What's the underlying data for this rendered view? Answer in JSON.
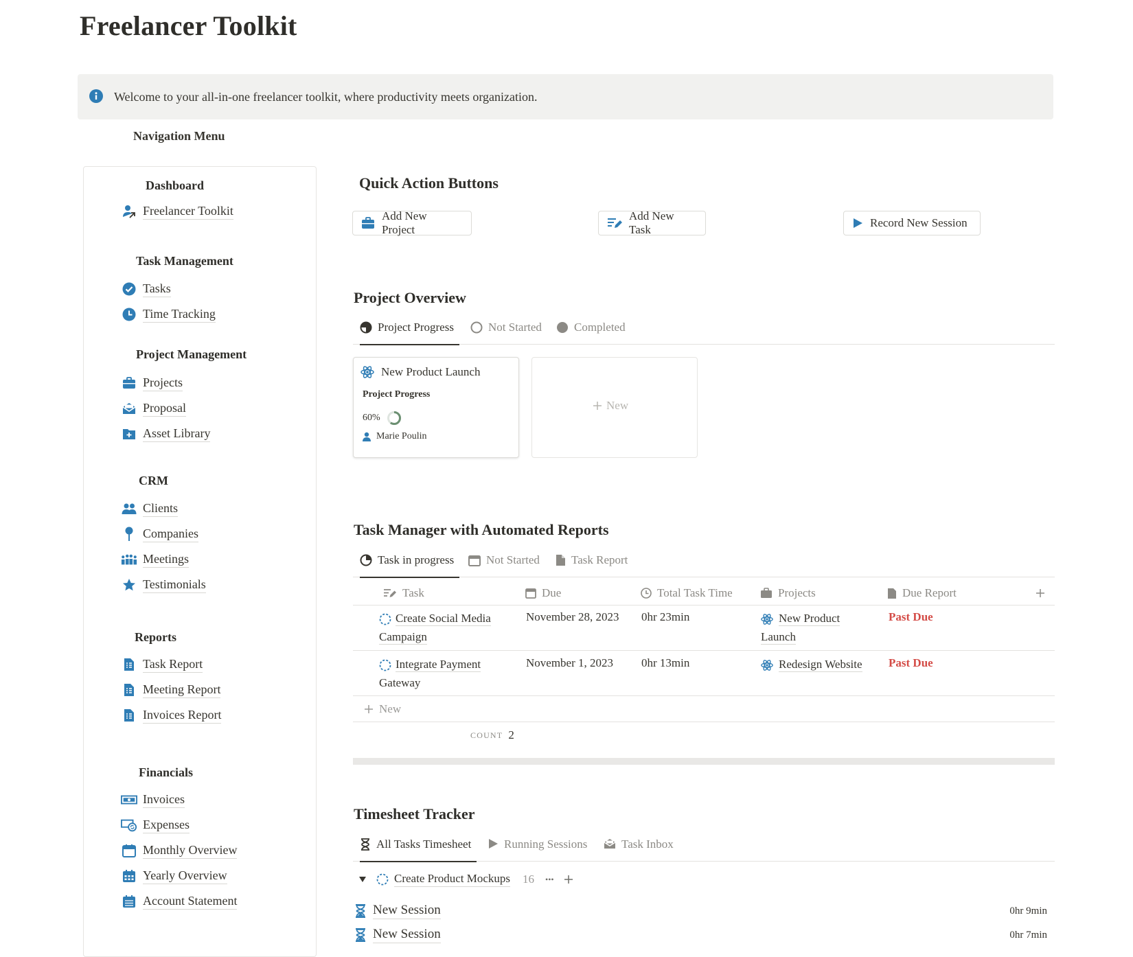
{
  "page": {
    "title": "Freelancer Toolkit"
  },
  "callout": {
    "text": "Welcome to your all-in-one freelancer toolkit, where productivity meets organization."
  },
  "nav": {
    "heading": "Navigation Menu",
    "sections": {
      "dashboard": "Dashboard",
      "task_management": "Task Management",
      "project_management": "Project Management",
      "crm": "CRM",
      "reports": "Reports",
      "financials": "Financials"
    },
    "items": {
      "freelancer_toolkit": "Freelancer Toolkit",
      "tasks": "Tasks",
      "time_tracking": "Time Tracking",
      "projects": "Projects",
      "proposal": "Proposal",
      "asset_library": "Asset Library",
      "clients": "Clients",
      "companies": "Companies",
      "meetings": "Meetings",
      "testimonials": "Testimonials",
      "task_report": "Task Report",
      "meeting_report": "Meeting Report",
      "invoices_report": "Invoices Report",
      "invoices": "Invoices",
      "expenses": "Expenses",
      "monthly_overview": "Monthly Overview",
      "yearly_overview": "Yearly Overview",
      "account_statement": "Account Statement"
    }
  },
  "quick_actions": {
    "title": "Quick Action Buttons",
    "add_project": "Add New Project",
    "add_task": "Add New Task",
    "record_session": "Record New Session"
  },
  "project_overview": {
    "title": "Project Overview",
    "tabs": {
      "progress": "Project Progress",
      "not_started": "Not Started",
      "completed": "Completed"
    },
    "card": {
      "name": "New Product Launch",
      "progress_label": "Project Progress",
      "progress_text": "60%",
      "progress_value": 0.6,
      "owner": "Marie Poulin"
    },
    "new_label": "New"
  },
  "task_manager": {
    "title": "Task Manager with Automated Reports",
    "tabs": {
      "in_progress": "Task in progress",
      "not_started": "Not Started",
      "report": "Task Report"
    },
    "columns": {
      "task": "Task",
      "due": "Due",
      "time": "Total Task Time",
      "projects": "Projects",
      "due_report": "Due Report"
    },
    "rows": [
      {
        "task_l1": "Create Social Media",
        "task_l2": "Campaign",
        "due": "November 28, 2023",
        "time": "0hr 23min",
        "project_l1": "New Product",
        "project_l2": "Launch",
        "report": "Past Due"
      },
      {
        "task_l1": "Integrate Payment",
        "task_l2": "Gateway",
        "due": "November 1, 2023",
        "time": "0hr 13min",
        "project_l1": "Redesign Website",
        "project_l2": "",
        "report": "Past Due"
      }
    ],
    "new_label": "New",
    "count_label": "COUNT",
    "count_value": "2"
  },
  "timesheet": {
    "title": "Timesheet Tracker",
    "tabs": {
      "all": "All Tasks Timesheet",
      "running": "Running Sessions",
      "inbox": "Task Inbox"
    },
    "group": {
      "name": "Create Product Mockups",
      "count": "16",
      "more": "•••"
    },
    "sessions": [
      {
        "name": "New Session",
        "duration": "0hr 9min"
      },
      {
        "name": "New Session",
        "duration": "0hr 7min"
      }
    ]
  },
  "colors": {
    "accent": "#2f7db5",
    "past_due": "#d44c47",
    "callout_bg": "#f1f1ef",
    "progress_ring": "#6b8f71"
  },
  "icons": {
    "callout": "info-icon",
    "nav_toolkit": "person-arrow-icon",
    "tasks": "check-circle-icon",
    "time": "clock-icon",
    "projects": "briefcase-icon",
    "proposal": "envelope-open-icon",
    "assets": "folder-plus-icon",
    "clients": "people-icon",
    "companies": "pin-icon",
    "meetings": "group-icon",
    "testimonials": "star-icon",
    "reports": "report-doc-icon",
    "invoices": "money-icon",
    "expenses": "cash-sync-icon",
    "calendar": "calendar-icon",
    "account": "ledger-icon"
  }
}
